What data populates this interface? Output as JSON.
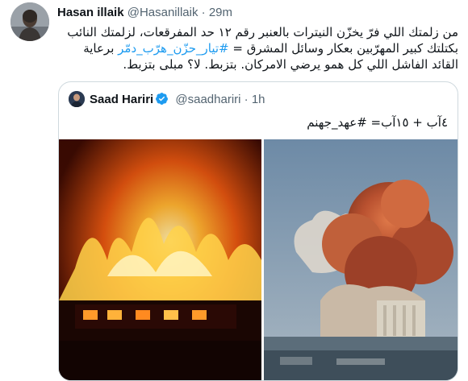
{
  "tweet": {
    "author_name": "Hasan illaik",
    "author_handle": "@Hasanillaik",
    "separator": "·",
    "time": "29m",
    "text_part1": "من زلمتك اللي فرّ يخزّن النيترات بالعنبر رقم ١٢ حد المفرقعات، لزلمتك النائب بكتلتك كبير المهرّبين بعكار وسائل المشرق = ",
    "hashtag": "#تيار_حزّن_هرّب_دمّر",
    "text_part2": " برعاية القائد الفاشل اللي كل همو يرضي الامركان. بتزبط. لا؟ مبلى بتزبط."
  },
  "quoted": {
    "author_name": "Saad Hariri",
    "author_handle": "@saadhariri",
    "separator": "·",
    "time": "1h",
    "text": "٤آب + ١٥آب= #عهد_جهنم",
    "images": [
      {
        "icon": "building-fire-photo"
      },
      {
        "icon": "port-explosion-photo"
      }
    ]
  },
  "colors": {
    "text": "#0f1419",
    "secondary": "#536471",
    "link": "#1d9bf0",
    "border": "#cfd9de",
    "verified": "#1d9bf0"
  }
}
